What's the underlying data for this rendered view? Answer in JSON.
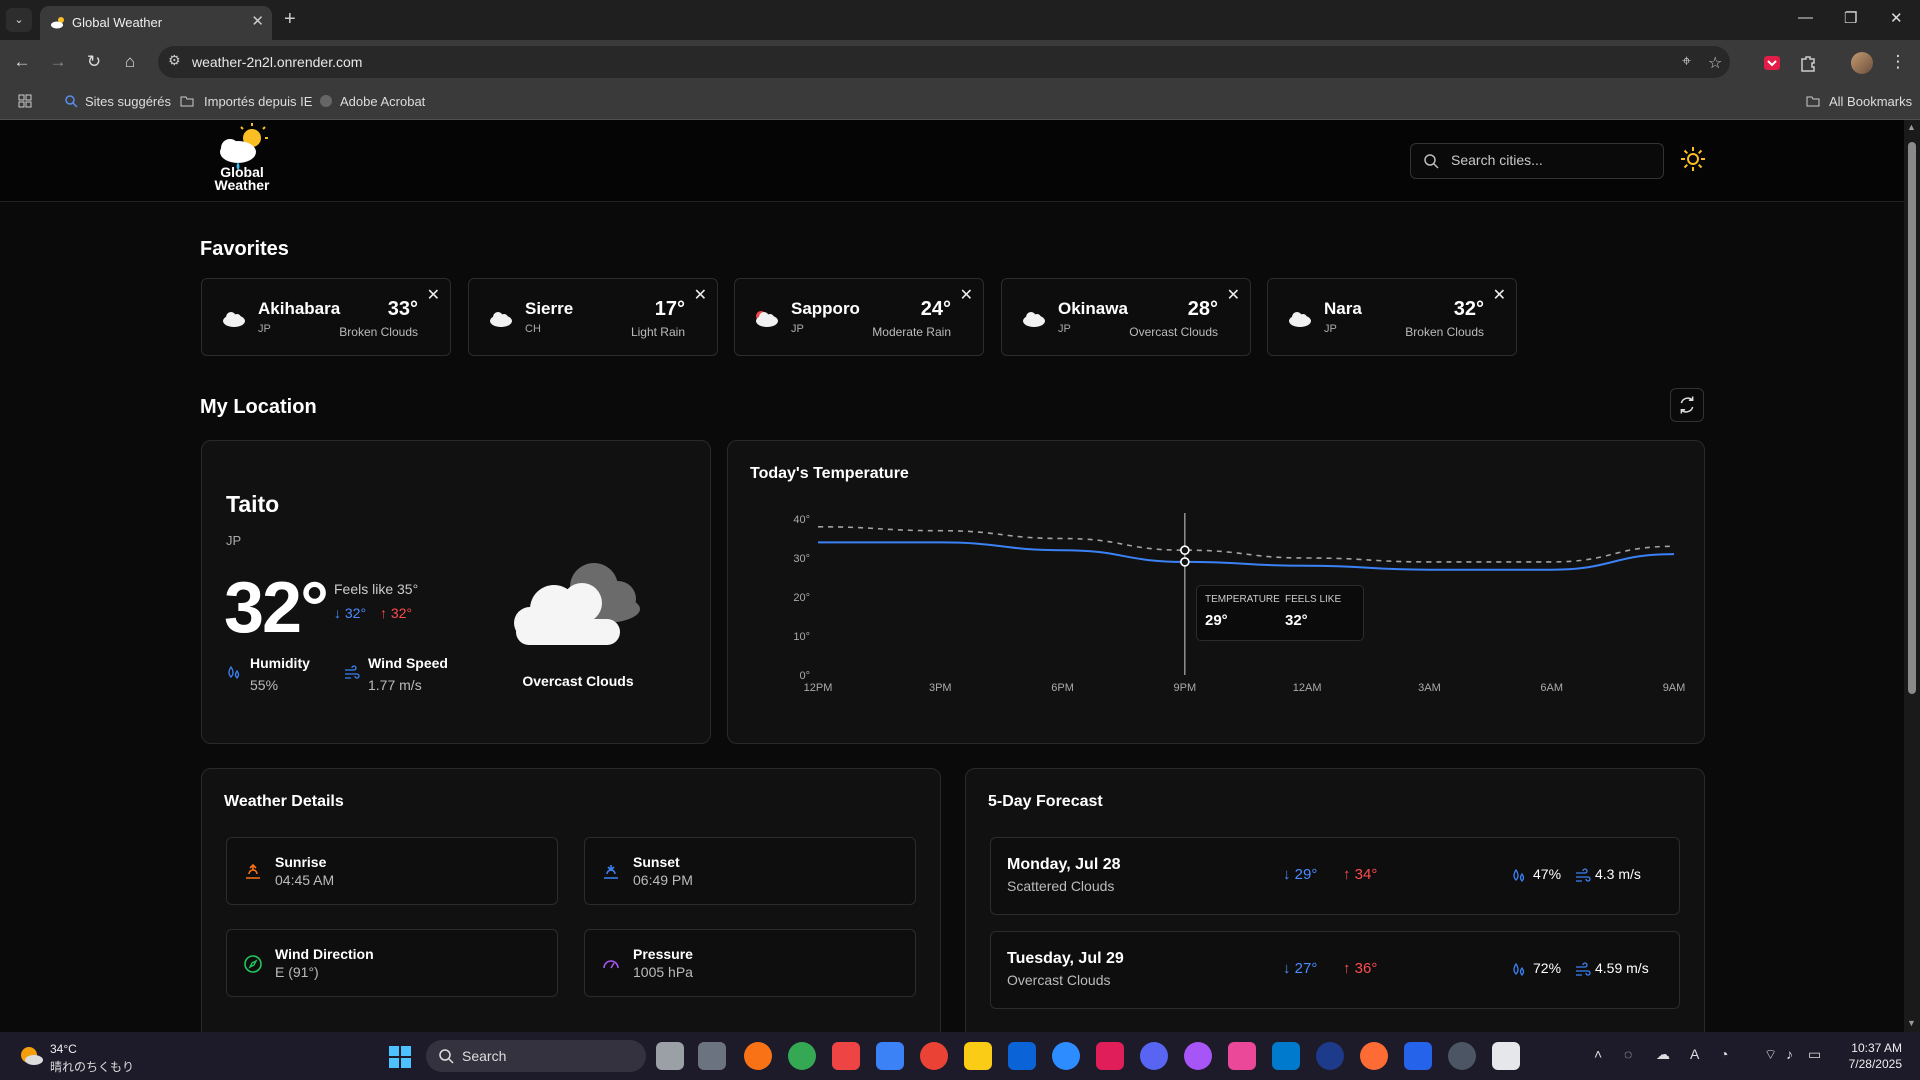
{
  "browser": {
    "tab_title": "Global Weather",
    "url": "weather-2n2l.onrender.com",
    "bookmarks": [
      "Sites suggérés",
      "Importés depuis IE",
      "Adobe Acrobat"
    ],
    "all_bookmarks": "All Bookmarks"
  },
  "header": {
    "logo_line1": "Global",
    "logo_line2": "Weather",
    "search_placeholder": "Search cities..."
  },
  "favorites": {
    "title": "Favorites",
    "items": [
      {
        "name": "Akihabara",
        "country": "JP",
        "temp": "33°",
        "desc": "Broken Clouds",
        "icon": "cloud-icon"
      },
      {
        "name": "Sierre",
        "country": "CH",
        "temp": "17°",
        "desc": "Light Rain",
        "icon": "cloud-icon"
      },
      {
        "name": "Sapporo",
        "country": "JP",
        "temp": "24°",
        "desc": "Moderate Rain",
        "icon": "rain-cloud-icon"
      },
      {
        "name": "Okinawa",
        "country": "JP",
        "temp": "28°",
        "desc": "Overcast Clouds",
        "icon": "cloud-icon"
      },
      {
        "name": "Nara",
        "country": "JP",
        "temp": "32°",
        "desc": "Broken Clouds",
        "icon": "cloud-icon"
      }
    ],
    "close_label": "✕"
  },
  "my_location": {
    "title": "My Location",
    "city": "Taito",
    "country": "JP",
    "temp": "32°",
    "feels_like": "Feels like 35°",
    "low": "↓ 32°",
    "high": "↑ 32°",
    "humidity_label": "Humidity",
    "humidity": "55%",
    "wind_label": "Wind Speed",
    "wind": "1.77 m/s",
    "condition": "Overcast Clouds"
  },
  "temperature_chart": {
    "title": "Today's Temperature",
    "tooltip": {
      "temp_label": "TEMPERATURE",
      "temp": "29°",
      "feels_label": "FEELS LIKE",
      "feels": "32°"
    }
  },
  "chart_data": {
    "type": "line",
    "title": "Today's Temperature",
    "x": [
      "12PM",
      "3PM",
      "6PM",
      "9PM",
      "12AM",
      "3AM",
      "6AM",
      "9AM"
    ],
    "ylim": [
      0,
      40
    ],
    "yticks": [
      "0°",
      "10°",
      "20°",
      "30°",
      "40°"
    ],
    "series": [
      {
        "name": "TEMPERATURE",
        "color": "#3b82f6",
        "style": "solid",
        "values": [
          34,
          34,
          32,
          29,
          28,
          27,
          27,
          31
        ]
      },
      {
        "name": "FEELS LIKE",
        "color": "#a3a3a3",
        "style": "dashed",
        "values": [
          38,
          37,
          35,
          32,
          30,
          29,
          29,
          33
        ]
      }
    ],
    "grid": false
  },
  "weather_details": {
    "title": "Weather Details",
    "items": [
      {
        "label": "Sunrise",
        "value": "04:45 AM",
        "icon": "sunrise-icon",
        "color": "#f97316"
      },
      {
        "label": "Sunset",
        "value": "06:49 PM",
        "icon": "sunset-icon",
        "color": "#3b82f6"
      },
      {
        "label": "Wind Direction",
        "value": "E (91°)",
        "icon": "compass-icon",
        "color": "#22c55e"
      },
      {
        "label": "Pressure",
        "value": "1005 hPa",
        "icon": "gauge-icon",
        "color": "#a855f7"
      }
    ]
  },
  "forecast": {
    "title": "5-Day Forecast",
    "days": [
      {
        "day": "Monday, Jul 28",
        "desc": "Scattered Clouds",
        "low": "↓ 29°",
        "high": "↑ 34°",
        "humidity": "47%",
        "wind": "4.3 m/s"
      },
      {
        "day": "Tuesday, Jul 29",
        "desc": "Overcast Clouds",
        "low": "↓ 27°",
        "high": "↑ 36°",
        "humidity": "72%",
        "wind": "4.59 m/s"
      }
    ]
  },
  "taskbar": {
    "weather_temp": "34°C",
    "weather_desc": "晴れのちくもり",
    "search_label": "Search",
    "time": "10:37 AM",
    "date": "7/28/2025"
  }
}
